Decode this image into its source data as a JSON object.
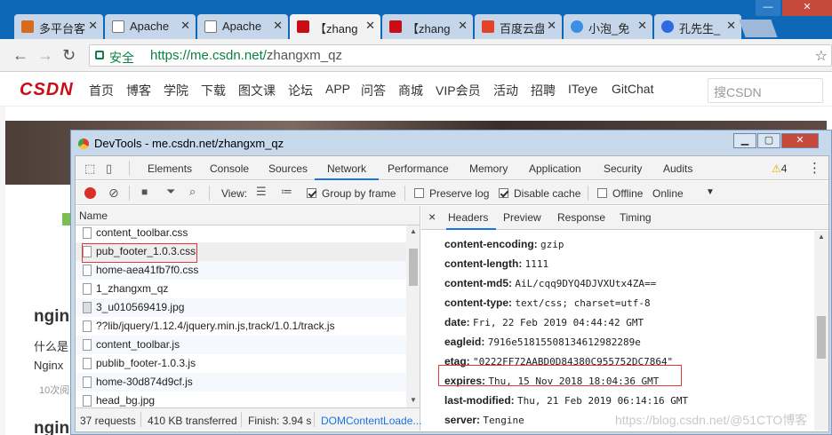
{
  "browser": {
    "tabs": [
      {
        "label": "多平台客",
        "fav_color": "#d86a1b"
      },
      {
        "label": "Apache",
        "fav_color": "#ffffff"
      },
      {
        "label": "Apache",
        "fav_color": "#ffffff"
      },
      {
        "label": "【zhang",
        "fav_color": "#ca0c16"
      },
      {
        "label": "【zhang",
        "fav_color": "#ca0c16"
      },
      {
        "label": "百度云盘",
        "fav_color": "#e24329"
      },
      {
        "label": "小泡_免",
        "fav_color": "#3b8ee2"
      },
      {
        "label": "孔先生_",
        "fav_color": "#2f6ae0"
      }
    ],
    "window_controls": {
      "minimize": "—",
      "close": "✕"
    },
    "secure_label": "安全",
    "url_host": "https://me.csdn.net/",
    "url_path": "zhangxm_qz",
    "back_icon": "←",
    "forward_icon": "→",
    "reload_icon": "↻",
    "star_icon": "☆"
  },
  "csdn": {
    "logo": "CSDN",
    "nav": [
      "首页",
      "博客",
      "学院",
      "下载",
      "图文课",
      "论坛",
      "APP",
      "问答",
      "商城",
      "VIP会员",
      "活动",
      "招聘",
      "ITeye",
      "GitChat"
    ],
    "search_placeholder": "搜CSDN",
    "bg": {
      "t1": "ngin",
      "t2": "什么是",
      "t3": "Nginx",
      "t4": "10次阅",
      "t5": "ngin"
    }
  },
  "devtools": {
    "title": "DevTools - me.csdn.net/zhangxm_qz",
    "panels": [
      "Elements",
      "Console",
      "Sources",
      "Network",
      "Performance",
      "Memory",
      "Application",
      "Security",
      "Audits"
    ],
    "active_panel": "Network",
    "warnings": "4",
    "toolbar": {
      "view_label": "View:",
      "group_by_frame": "Group by frame",
      "preserve_log": "Preserve log",
      "disable_cache": "Disable cache",
      "offline": "Offline",
      "throttle": "Online"
    },
    "list_header": "Name",
    "requests": [
      "content_toolbar.css",
      "pub_footer_1.0.3.css",
      "home-aea41fb7f0.css",
      "1_zhangxm_qz",
      "3_u010569419.jpg",
      "??lib/jquery/1.12.4/jquery.min.js,track/1.0.1/track.js",
      "content_toolbar.js",
      "publib_footer-1.0.3.js",
      "home-30d874d9cf.js",
      "head_bg.jpg"
    ],
    "status": {
      "requests": "37 requests",
      "transferred": "410 KB transferred",
      "finish": "Finish: 3.94 s",
      "dcl": "DOMContentLoade..."
    },
    "detail_tabs": [
      "Headers",
      "Preview",
      "Response",
      "Timing"
    ],
    "active_detail_tab": "Headers",
    "headers": [
      {
        "k": "content-encoding:",
        "v": "gzip"
      },
      {
        "k": "content-length:",
        "v": "1111"
      },
      {
        "k": "content-md5:",
        "v": "AiL/cqq9DYQ4DJVXUtx4ZA=="
      },
      {
        "k": "content-type:",
        "v": "text/css; charset=utf-8"
      },
      {
        "k": "date:",
        "v": "Fri, 22 Feb 2019 04:44:42 GMT"
      },
      {
        "k": "eagleid:",
        "v": "7916e51815508134612982289e"
      },
      {
        "k": "etag:",
        "v": "\"0222FF72AABD0D84380C955752DC7864\""
      },
      {
        "k": "expires:",
        "v": "Thu, 15 Nov 2018 18:04:36 GMT"
      },
      {
        "k": "last-modified:",
        "v": "Thu, 21 Feb 2019 06:14:16 GMT"
      },
      {
        "k": "server:",
        "v": "Tengine"
      }
    ]
  },
  "watermark": "https://blog.csdn.net/@51CTO博客"
}
